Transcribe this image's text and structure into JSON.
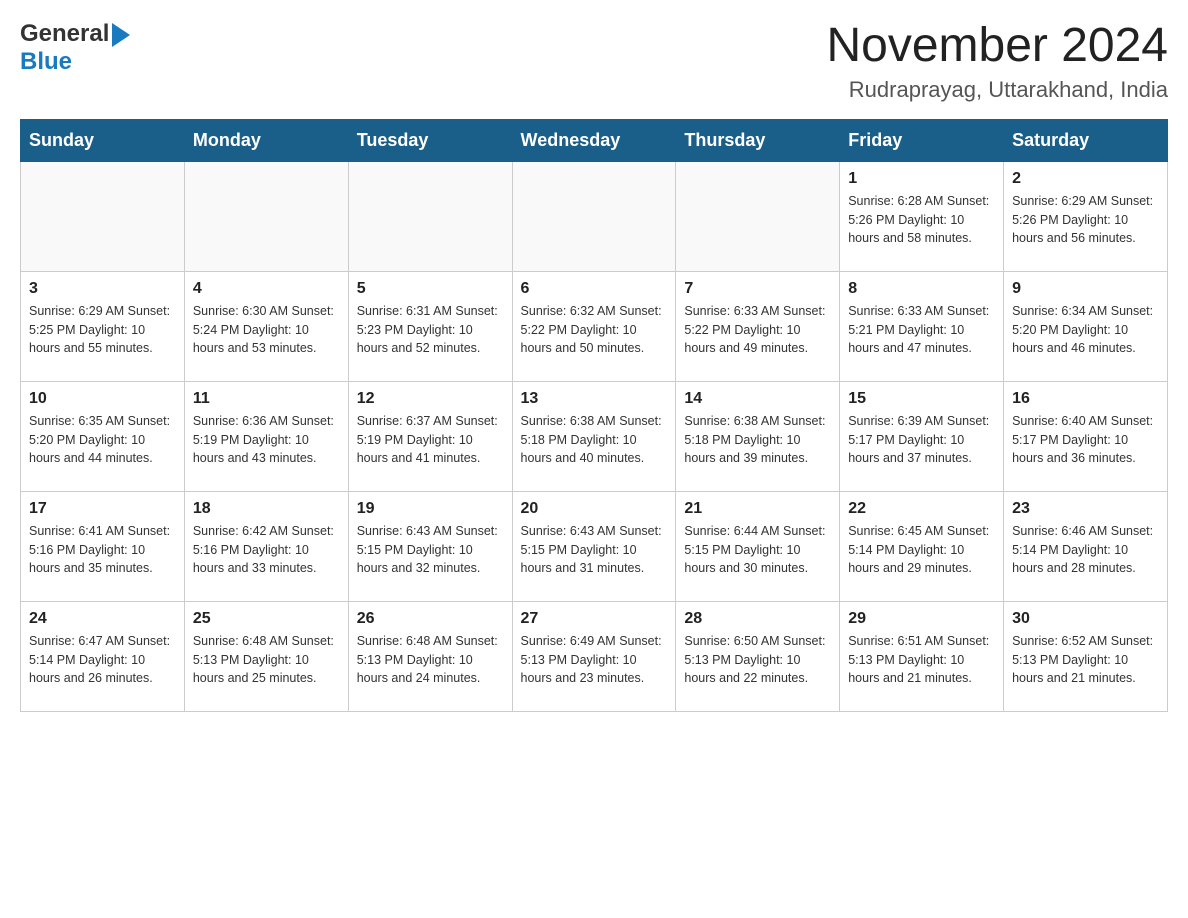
{
  "header": {
    "logo_line1": "General",
    "logo_line2": "Blue",
    "title": "November 2024",
    "location": "Rudraprayag, Uttarakhand, India"
  },
  "days_of_week": [
    "Sunday",
    "Monday",
    "Tuesday",
    "Wednesday",
    "Thursday",
    "Friday",
    "Saturday"
  ],
  "weeks": [
    {
      "days": [
        {
          "date": "",
          "info": ""
        },
        {
          "date": "",
          "info": ""
        },
        {
          "date": "",
          "info": ""
        },
        {
          "date": "",
          "info": ""
        },
        {
          "date": "",
          "info": ""
        },
        {
          "date": "1",
          "info": "Sunrise: 6:28 AM\nSunset: 5:26 PM\nDaylight: 10 hours and 58 minutes."
        },
        {
          "date": "2",
          "info": "Sunrise: 6:29 AM\nSunset: 5:26 PM\nDaylight: 10 hours and 56 minutes."
        }
      ]
    },
    {
      "days": [
        {
          "date": "3",
          "info": "Sunrise: 6:29 AM\nSunset: 5:25 PM\nDaylight: 10 hours and 55 minutes."
        },
        {
          "date": "4",
          "info": "Sunrise: 6:30 AM\nSunset: 5:24 PM\nDaylight: 10 hours and 53 minutes."
        },
        {
          "date": "5",
          "info": "Sunrise: 6:31 AM\nSunset: 5:23 PM\nDaylight: 10 hours and 52 minutes."
        },
        {
          "date": "6",
          "info": "Sunrise: 6:32 AM\nSunset: 5:22 PM\nDaylight: 10 hours and 50 minutes."
        },
        {
          "date": "7",
          "info": "Sunrise: 6:33 AM\nSunset: 5:22 PM\nDaylight: 10 hours and 49 minutes."
        },
        {
          "date": "8",
          "info": "Sunrise: 6:33 AM\nSunset: 5:21 PM\nDaylight: 10 hours and 47 minutes."
        },
        {
          "date": "9",
          "info": "Sunrise: 6:34 AM\nSunset: 5:20 PM\nDaylight: 10 hours and 46 minutes."
        }
      ]
    },
    {
      "days": [
        {
          "date": "10",
          "info": "Sunrise: 6:35 AM\nSunset: 5:20 PM\nDaylight: 10 hours and 44 minutes."
        },
        {
          "date": "11",
          "info": "Sunrise: 6:36 AM\nSunset: 5:19 PM\nDaylight: 10 hours and 43 minutes."
        },
        {
          "date": "12",
          "info": "Sunrise: 6:37 AM\nSunset: 5:19 PM\nDaylight: 10 hours and 41 minutes."
        },
        {
          "date": "13",
          "info": "Sunrise: 6:38 AM\nSunset: 5:18 PM\nDaylight: 10 hours and 40 minutes."
        },
        {
          "date": "14",
          "info": "Sunrise: 6:38 AM\nSunset: 5:18 PM\nDaylight: 10 hours and 39 minutes."
        },
        {
          "date": "15",
          "info": "Sunrise: 6:39 AM\nSunset: 5:17 PM\nDaylight: 10 hours and 37 minutes."
        },
        {
          "date": "16",
          "info": "Sunrise: 6:40 AM\nSunset: 5:17 PM\nDaylight: 10 hours and 36 minutes."
        }
      ]
    },
    {
      "days": [
        {
          "date": "17",
          "info": "Sunrise: 6:41 AM\nSunset: 5:16 PM\nDaylight: 10 hours and 35 minutes."
        },
        {
          "date": "18",
          "info": "Sunrise: 6:42 AM\nSunset: 5:16 PM\nDaylight: 10 hours and 33 minutes."
        },
        {
          "date": "19",
          "info": "Sunrise: 6:43 AM\nSunset: 5:15 PM\nDaylight: 10 hours and 32 minutes."
        },
        {
          "date": "20",
          "info": "Sunrise: 6:43 AM\nSunset: 5:15 PM\nDaylight: 10 hours and 31 minutes."
        },
        {
          "date": "21",
          "info": "Sunrise: 6:44 AM\nSunset: 5:15 PM\nDaylight: 10 hours and 30 minutes."
        },
        {
          "date": "22",
          "info": "Sunrise: 6:45 AM\nSunset: 5:14 PM\nDaylight: 10 hours and 29 minutes."
        },
        {
          "date": "23",
          "info": "Sunrise: 6:46 AM\nSunset: 5:14 PM\nDaylight: 10 hours and 28 minutes."
        }
      ]
    },
    {
      "days": [
        {
          "date": "24",
          "info": "Sunrise: 6:47 AM\nSunset: 5:14 PM\nDaylight: 10 hours and 26 minutes."
        },
        {
          "date": "25",
          "info": "Sunrise: 6:48 AM\nSunset: 5:13 PM\nDaylight: 10 hours and 25 minutes."
        },
        {
          "date": "26",
          "info": "Sunrise: 6:48 AM\nSunset: 5:13 PM\nDaylight: 10 hours and 24 minutes."
        },
        {
          "date": "27",
          "info": "Sunrise: 6:49 AM\nSunset: 5:13 PM\nDaylight: 10 hours and 23 minutes."
        },
        {
          "date": "28",
          "info": "Sunrise: 6:50 AM\nSunset: 5:13 PM\nDaylight: 10 hours and 22 minutes."
        },
        {
          "date": "29",
          "info": "Sunrise: 6:51 AM\nSunset: 5:13 PM\nDaylight: 10 hours and 21 minutes."
        },
        {
          "date": "30",
          "info": "Sunrise: 6:52 AM\nSunset: 5:13 PM\nDaylight: 10 hours and 21 minutes."
        }
      ]
    }
  ]
}
